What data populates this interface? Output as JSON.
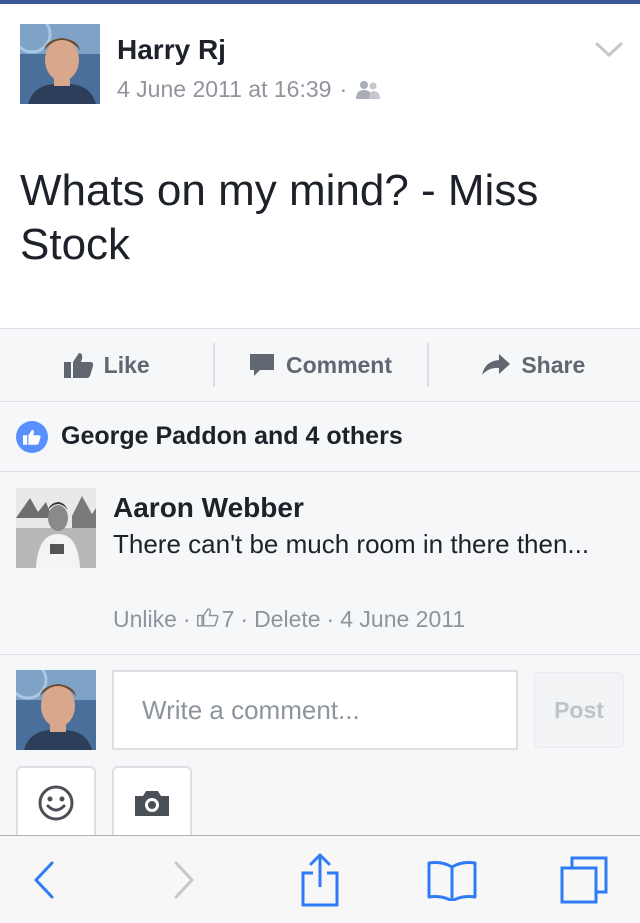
{
  "post": {
    "author": "Harry Rj",
    "timestamp": "4 June 2011 at 16:39",
    "separator": "·",
    "audience_icon": "friends-icon",
    "text": "Whats on my mind? - Miss Stock"
  },
  "actions": {
    "like": "Like",
    "comment": "Comment",
    "share": "Share"
  },
  "likes": {
    "summary": "George Paddon and 4 others"
  },
  "comment": {
    "author": "Aaron Webber",
    "text": "There can't be much room in there then...",
    "unlike": "Unlike",
    "like_count": "7",
    "delete": "Delete",
    "date": "4 June 2011",
    "separator": "·"
  },
  "composer": {
    "placeholder": "Write a comment...",
    "post_label": "Post"
  },
  "colors": {
    "brand": "#3b5998",
    "like_blue": "#5890ff",
    "ios_blue": "#2d7cf6",
    "muted": "#90949c"
  }
}
